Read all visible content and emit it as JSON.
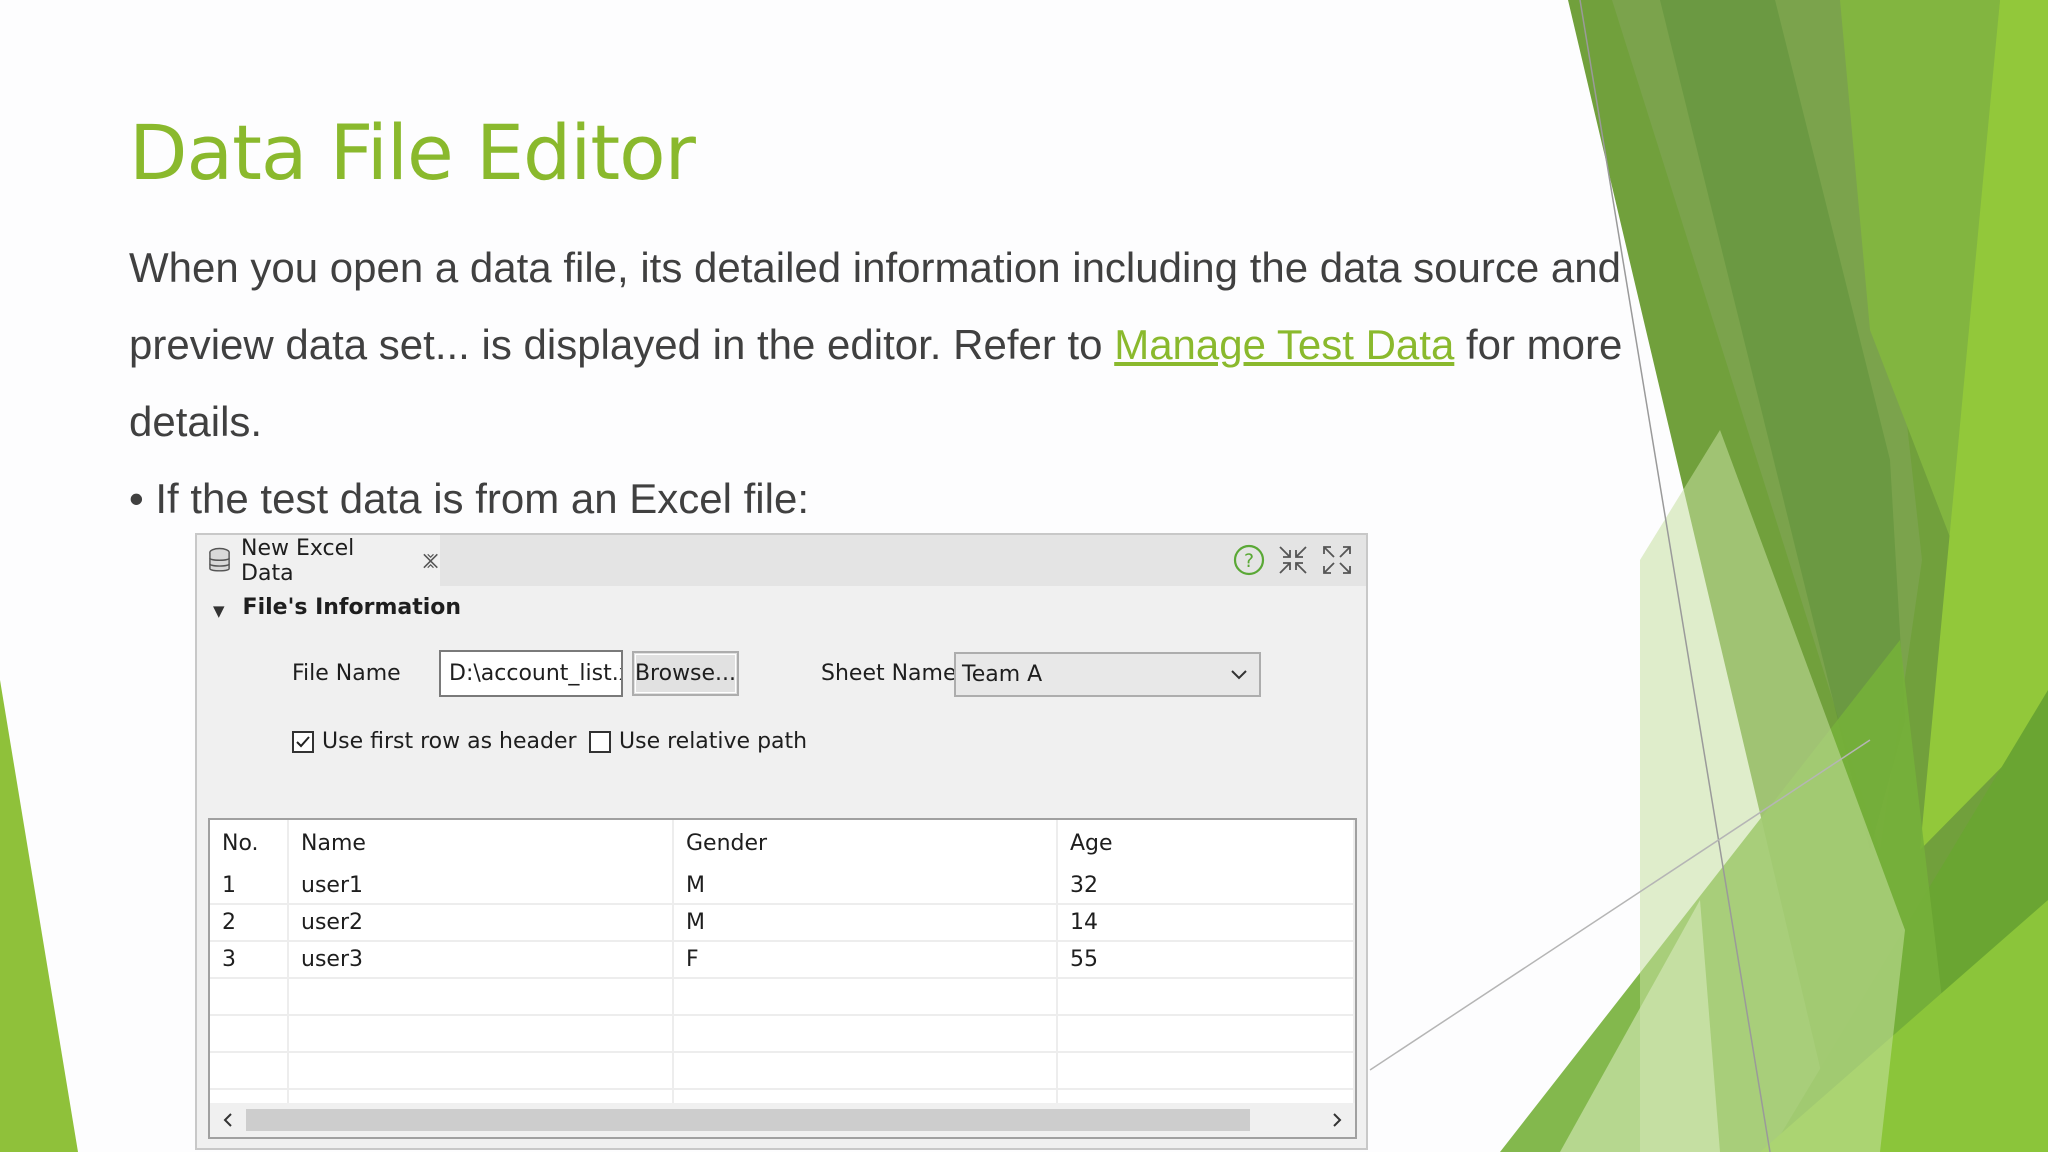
{
  "slide": {
    "title": "Data File Editor",
    "para_before_link": "When you open a data file, its detailed information including the data source and preview data set... is displayed in the editor. Refer to ",
    "link_text": "Manage Test Data",
    "para_after_link": " for more details.",
    "bullet": "• If the test data is from an Excel file:"
  },
  "editor": {
    "tab_label": "New Excel Data",
    "section_title": "File's Information",
    "file_name_label": "File Name",
    "file_name_value": "D:\\account_list.x",
    "browse_label": "Browse...",
    "sheet_name_label": "Sheet Name",
    "sheet_name_value": "Team A",
    "use_first_row_label": "Use first row as header",
    "use_first_row_checked": true,
    "use_relative_path_label": "Use relative path",
    "use_relative_path_checked": false,
    "columns": [
      "No.",
      "Name",
      "Gender",
      "Age"
    ],
    "rows": [
      [
        "1",
        "user1",
        "M",
        "32"
      ],
      [
        "2",
        "user2",
        "M",
        "14"
      ],
      [
        "3",
        "user3",
        "F",
        "55"
      ]
    ],
    "icons": [
      "database-icon",
      "close-icon",
      "help-icon",
      "minimize-icon",
      "maximize-icon",
      "chevron-down-icon",
      "scroll-left-icon",
      "scroll-right-icon"
    ]
  },
  "colors": {
    "accent_green": "#8ab92d",
    "body_text": "#404040"
  }
}
